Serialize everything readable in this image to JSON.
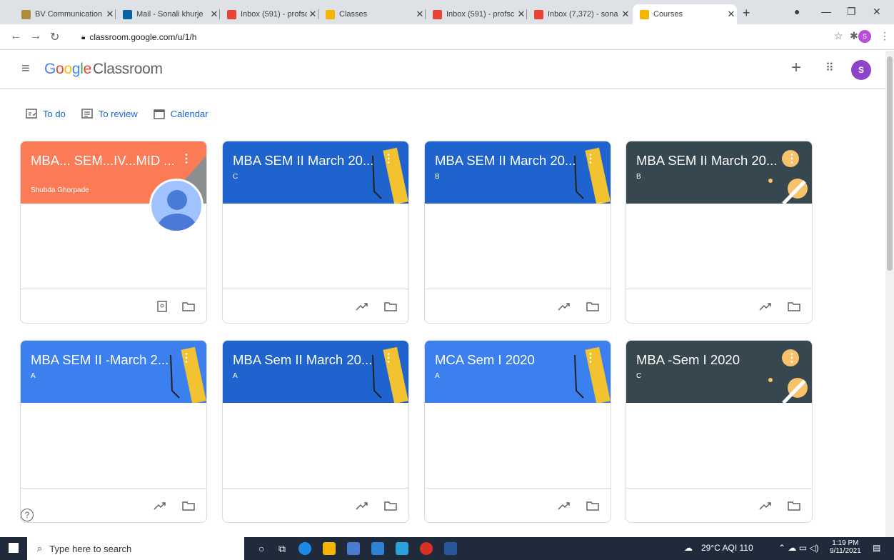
{
  "browser": {
    "tabs": [
      {
        "title": "BV Communication",
        "color": "#b08b3c"
      },
      {
        "title": "Mail - Sonali khurje",
        "color": "#0a64a4"
      },
      {
        "title": "Inbox (591) - profsc",
        "color": "#ea4335"
      },
      {
        "title": "Classes",
        "color": "#f4b400"
      },
      {
        "title": "Inbox (591) - profsc",
        "color": "#ea4335"
      },
      {
        "title": "Inbox (7,372) - sona",
        "color": "#ea4335"
      },
      {
        "title": "Courses",
        "color": "#f4b400"
      }
    ],
    "url": "classroom.google.com/u/1/h",
    "profile_initial": "S"
  },
  "app": {
    "logo_google": "Google",
    "logo_classroom": "Classroom",
    "avatar_initial": "S"
  },
  "subnav": {
    "todo": "To do",
    "review": "To review",
    "calendar": "Calendar"
  },
  "courses": [
    {
      "title": "MBA... SEM...IV...MID ...",
      "section": "",
      "owner": "Shubda Ghorpade",
      "theme": "orange"
    },
    {
      "title": "MBA SEM II March 20...",
      "section": "C",
      "owner": "",
      "theme": "blue"
    },
    {
      "title": "MBA SEM II March 20...",
      "section": "B",
      "owner": "",
      "theme": "blue"
    },
    {
      "title": "MBA SEM II March 20...",
      "section": "B",
      "owner": "",
      "theme": "dark"
    },
    {
      "title": "MBA SEM II -March 2...",
      "section": "A",
      "owner": "",
      "theme": "blue2"
    },
    {
      "title": "MBA Sem II March 20...",
      "section": "A",
      "owner": "",
      "theme": "blue"
    },
    {
      "title": "MCA Sem I 2020",
      "section": "A",
      "owner": "",
      "theme": "blue2"
    },
    {
      "title": "MBA -Sem I 2020",
      "section": "C",
      "owner": "",
      "theme": "dark"
    }
  ],
  "taskbar": {
    "search_placeholder": "Type here to search",
    "weather": "29°C  AQI 110",
    "time": "1:19 PM",
    "date": "9/11/2021"
  }
}
